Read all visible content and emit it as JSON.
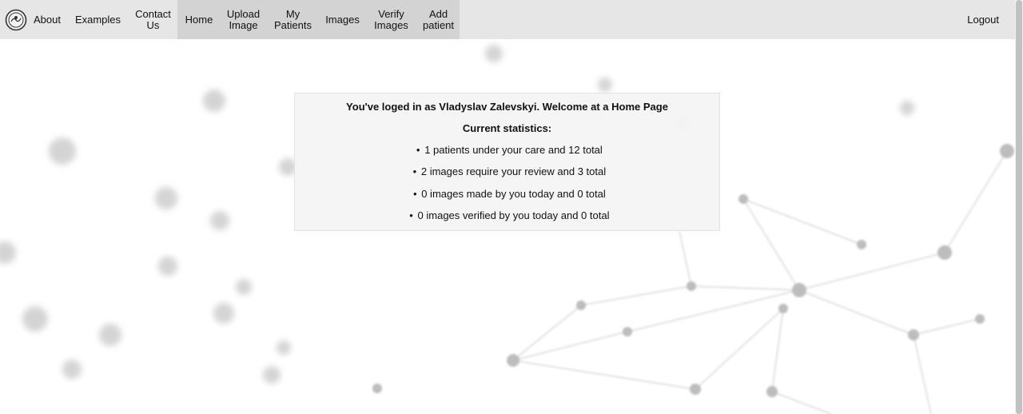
{
  "nav": {
    "items": [
      {
        "label_line1": "About",
        "label_line2": ""
      },
      {
        "label_line1": "Examples",
        "label_line2": ""
      },
      {
        "label_line1": "Contact",
        "label_line2": "Us"
      },
      {
        "label_line1": "Home",
        "label_line2": ""
      },
      {
        "label_line1": "Upload",
        "label_line2": "Image"
      },
      {
        "label_line1": "My",
        "label_line2": "Patients"
      },
      {
        "label_line1": "Images",
        "label_line2": ""
      },
      {
        "label_line1": "Verify",
        "label_line2": "Images"
      },
      {
        "label_line1": "Add",
        "label_line2": "patient"
      }
    ],
    "active": "Home",
    "logout": "Logout"
  },
  "main": {
    "welcome": "You've loged in as Vladyslav Zalevskyi. Welcome at a Home Page",
    "stats_title": "Current statistics:",
    "stats": [
      "1 patients under your care and 12 total",
      "2 images require your review and 3 total",
      "0 images made by you today and 0 total",
      "0 images verified by you today and 0 total"
    ]
  },
  "colors": {
    "navbar": "#e6e6e6",
    "nav_active": "#d3d3d3",
    "card": "#f4f4f4"
  }
}
